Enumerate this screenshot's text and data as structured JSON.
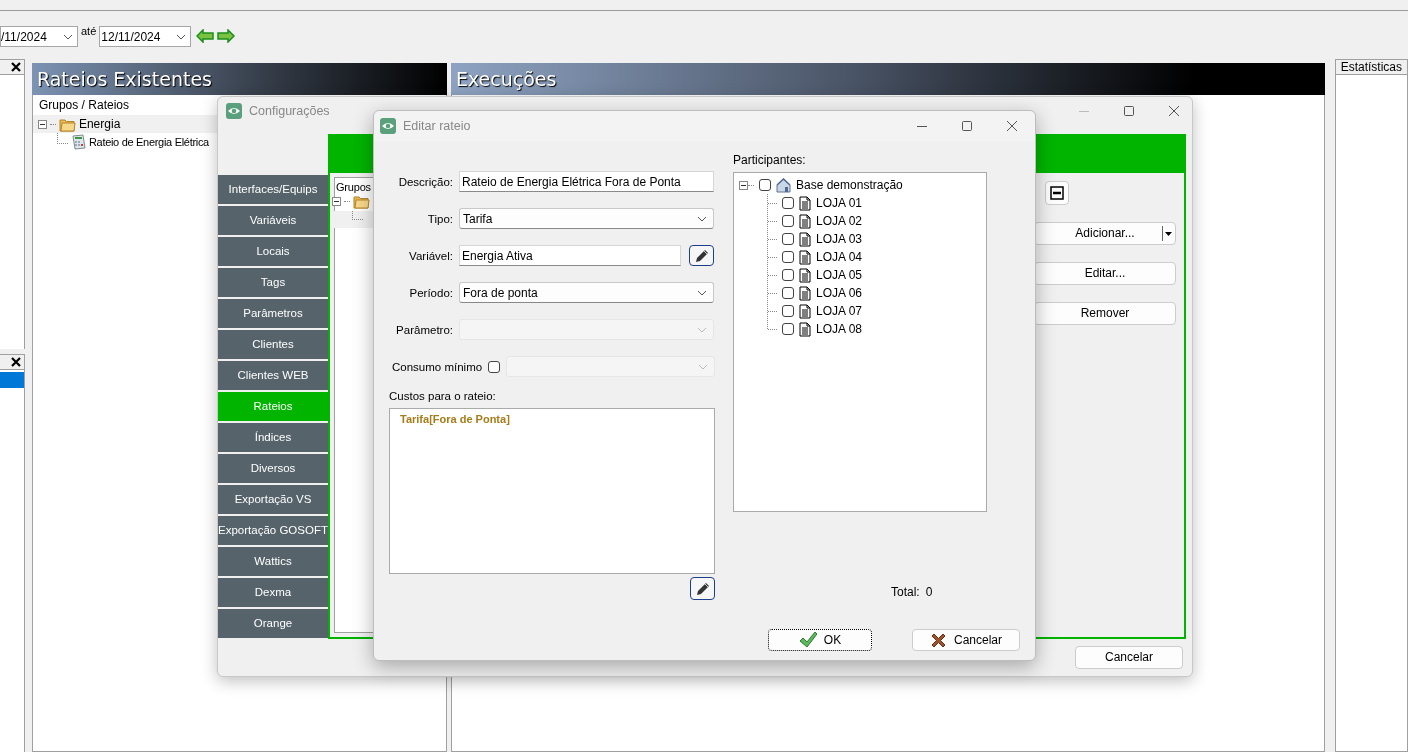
{
  "toolbar": {
    "date_from": "/11/2024",
    "until_label": "até",
    "date_to": "12/11/2024"
  },
  "side_panel": {
    "rows": [
      {
        "selected": true
      }
    ]
  },
  "rateios_panel": {
    "title": "Rateios Existentes",
    "column": "Grupos / Rateios",
    "tree": [
      {
        "label": "Energia",
        "expanded": true,
        "children": [
          {
            "label": "Rateio de Energia Elétrica"
          }
        ]
      }
    ]
  },
  "execucoes_panel": {
    "title": "Execuções"
  },
  "estatisticas_tab": {
    "label": "Estatísticas"
  },
  "config_dialog": {
    "title": "Configurações",
    "nav": [
      {
        "label": "Interfaces/Equips",
        "selected": false
      },
      {
        "label": "Variáveis",
        "selected": false
      },
      {
        "label": "Locais",
        "selected": false
      },
      {
        "label": "Tags",
        "selected": false
      },
      {
        "label": "Parâmetros",
        "selected": false
      },
      {
        "label": "Clientes",
        "selected": false
      },
      {
        "label": "Clientes WEB",
        "selected": false
      },
      {
        "label": "Rateios",
        "selected": true
      },
      {
        "label": "Índices",
        "selected": false
      },
      {
        "label": "Diversos",
        "selected": false
      },
      {
        "label": "Exportação VS",
        "selected": false
      },
      {
        "label": "Exportação GOSOFT",
        "selected": false
      },
      {
        "label": "Wattics",
        "selected": false
      },
      {
        "label": "Dexma",
        "selected": false
      },
      {
        "label": "Orange",
        "selected": false
      }
    ],
    "tree_header": "Grupos",
    "buttons": [
      {
        "label": "Adicionar...",
        "kind": "split"
      },
      {
        "label": "Editar...",
        "kind": "plain"
      },
      {
        "label": "Remover",
        "kind": "plain"
      }
    ],
    "footer_button": "Cancelar"
  },
  "edit_dialog": {
    "title": "Editar rateio",
    "fields": [
      {
        "kind": "text",
        "label": "Descrição:",
        "value": "Rateio de Energia Elétrica Fora de Ponta",
        "disabled": false
      },
      {
        "kind": "select",
        "label": "Tipo:",
        "value": "Tarifa",
        "disabled": false
      },
      {
        "kind": "text-button",
        "label": "Variável:",
        "value": "Energia Ativa",
        "disabled": false
      },
      {
        "kind": "select",
        "label": "Período:",
        "value": "Fora de ponta",
        "disabled": false
      },
      {
        "kind": "select",
        "label": "Parâmetro:",
        "disabled": true
      },
      {
        "kind": "check-select",
        "label": "Consumo mínimo",
        "checked": false,
        "disabled": true
      }
    ],
    "costs_label": "Custos para o rateio:",
    "costs": "Tarifa[Fora de Ponta]",
    "participants_label": "Participantes:",
    "participants": [
      {
        "label": "Base demonstração",
        "checked": false,
        "expanded": true,
        "children": [
          {
            "label": "LOJA 01",
            "checked": false
          },
          {
            "label": "LOJA 02",
            "checked": false
          },
          {
            "label": "LOJA 03",
            "checked": false
          },
          {
            "label": "LOJA 04",
            "checked": false
          },
          {
            "label": "LOJA 05",
            "checked": false
          },
          {
            "label": "LOJA 06",
            "checked": false
          },
          {
            "label": "LOJA 07",
            "checked": false
          },
          {
            "label": "LOJA 08",
            "checked": false
          }
        ]
      }
    ],
    "total_label": "Total:",
    "total": "0",
    "buttons": [
      {
        "label": "OK",
        "kind": "ok",
        "focused": true
      },
      {
        "label": "Cancelar",
        "kind": "cancel",
        "focused": false
      }
    ]
  }
}
